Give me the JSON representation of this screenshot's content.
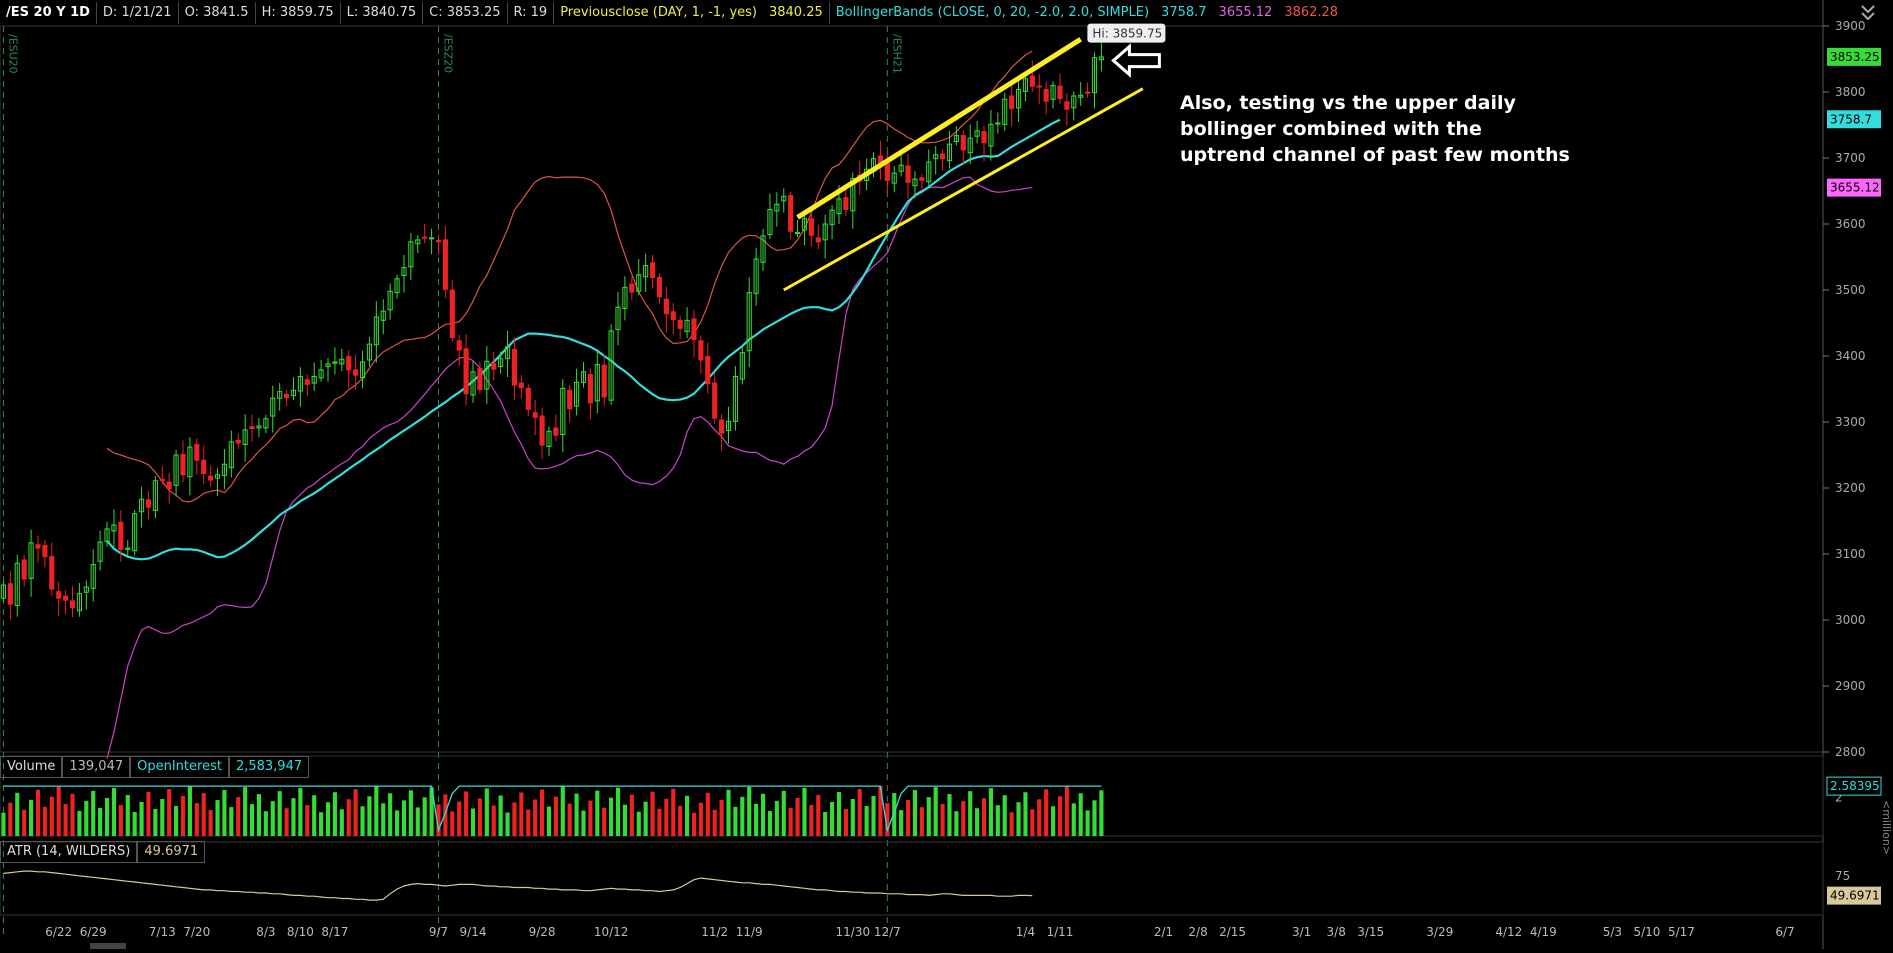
{
  "header": {
    "symbol": "/ES 20 Y 1D",
    "date": "D: 1/21/21",
    "open": "O: 3841.5",
    "high": "H: 3859.75",
    "low": "L: 3840.75",
    "close": "C: 3853.25",
    "range": "R: 19",
    "prev_close_label": "Previousclose (DAY, 1, -1, yes)",
    "prev_close_value": "3840.25",
    "bb_label": "BollingerBands (CLOSE, 0, 20, -2.0, 2.0, SIMPLE)",
    "bb_mid": "3758.7",
    "bb_lower": "3655.12",
    "bb_upper": "3862.28"
  },
  "annotation": {
    "text_lines": [
      "Also, testing vs the upper daily",
      "bollinger combined with the",
      "uptrend channel of past few months"
    ],
    "hi_label": "Hi: 3859.75"
  },
  "volume_panel": {
    "label": "Volume",
    "value": "139,047",
    "oi_label": "OpenInterest",
    "oi_value": "2,583,947",
    "scale_value": "2.58395",
    "unit": "<million>"
  },
  "atr_panel": {
    "label": "ATR (14, WILDERS)",
    "value": "49.6971",
    "scale_tick": "75"
  },
  "contract_markers": [
    "/ESU20",
    "/ESZ20",
    "/ESH21"
  ],
  "colors": {
    "up": "#33dd33",
    "down": "#ee2222",
    "bb_mid": "#33dddd",
    "bb_upper": "#dd5544",
    "bb_lower": "#cc44cc",
    "trend": "#ffee22",
    "atr": "#d8c89a",
    "prev_close": "#eeee44"
  },
  "chart_data": {
    "type": "candlestick",
    "ylim": [
      2800,
      3900
    ],
    "y_ticks": [
      2800,
      2900,
      3000,
      3100,
      3200,
      3300,
      3400,
      3500,
      3600,
      3700,
      3800,
      3900
    ],
    "price_tags": [
      {
        "value": 3853.25,
        "label": "3853.25",
        "color": "#33dd33"
      },
      {
        "value": 3758.7,
        "label": "3758.7",
        "color": "#33dddd"
      },
      {
        "value": 3655.12,
        "label": "3655.12",
        "color": "#ff66ff"
      }
    ],
    "x_tick_labels": [
      "6/22",
      "6/29",
      "7/13",
      "7/20",
      "8/3",
      "8/10",
      "8/17",
      "9/7",
      "9/14",
      "9/28",
      "10/12",
      "11/2",
      "11/9",
      "11/30",
      "12/7",
      "1/4",
      "1/11",
      "2/1",
      "2/8",
      "2/15",
      "3/1",
      "3/8",
      "3/15",
      "3/29",
      "4/12",
      "4/19",
      "5/3",
      "5/10",
      "5/17",
      "6/7"
    ],
    "x_tick_idx": [
      8,
      13,
      23,
      28,
      38,
      43,
      48,
      63,
      68,
      78,
      88,
      103,
      108,
      123,
      128,
      148,
      153,
      168,
      173,
      178,
      188,
      193,
      198,
      208,
      218,
      223,
      233,
      238,
      243,
      258
    ],
    "n_slots": 264,
    "n_bars": 150,
    "close": [
      3053,
      3024,
      3086,
      3062,
      3117,
      3109,
      3096,
      3047,
      3033,
      3030,
      3019,
      3040,
      3050,
      3084,
      3118,
      3138,
      3144,
      3107,
      3109,
      3161,
      3183,
      3171,
      3211,
      3211,
      3199,
      3250,
      3220,
      3262,
      3242,
      3222,
      3212,
      3220,
      3236,
      3270,
      3268,
      3288,
      3290,
      3294,
      3305,
      3336,
      3346,
      3337,
      3348,
      3369,
      3357,
      3369,
      3379,
      3388,
      3391,
      3395,
      3379,
      3371,
      3391,
      3418,
      3459,
      3468,
      3498,
      3517,
      3534,
      3573,
      3576,
      3579,
      3579,
      3573,
      3501,
      3428,
      3409,
      3343,
      3376,
      3349,
      3392,
      3380,
      3396,
      3414,
      3356,
      3352,
      3319,
      3307,
      3265,
      3286,
      3280,
      3351,
      3320,
      3360,
      3376,
      3329,
      3387,
      3338,
      3438,
      3474,
      3504,
      3497,
      3523,
      3537,
      3519,
      3490,
      3464,
      3455,
      3442,
      3454,
      3425,
      3394,
      3358,
      3306,
      3283,
      3301,
      3369,
      3405,
      3496,
      3547,
      3582,
      3622,
      3630,
      3642,
      3589,
      3587,
      3608,
      3583,
      3573,
      3600,
      3621,
      3638,
      3622,
      3669,
      3665,
      3683,
      3699,
      3693,
      3666,
      3677,
      3689,
      3663,
      3668,
      3666,
      3694,
      3705,
      3699,
      3721,
      3734,
      3712,
      3730,
      3741,
      3723,
      3751,
      3753,
      3789,
      3775,
      3804,
      3820,
      3809,
      3808,
      3786,
      3810,
      3790,
      3774,
      3794,
      3795,
      3798,
      3852,
      3853
    ],
    "bb_upper": [
      3260,
      3253,
      3250,
      3246,
      3243,
      3240,
      3235,
      3224,
      3210,
      3196,
      3189,
      3180,
      3179,
      3184,
      3192,
      3195,
      3197,
      3193,
      3204,
      3221,
      3234,
      3244,
      3256,
      3265,
      3277,
      3290,
      3295,
      3303,
      3304,
      3299,
      3300,
      3310,
      3320,
      3334,
      3339,
      3349,
      3356,
      3366,
      3381,
      3396,
      3406,
      3412,
      3418,
      3424,
      3425,
      3427,
      3428,
      3433,
      3441,
      3448,
      3449,
      3452,
      3464,
      3483,
      3506,
      3522,
      3545,
      3568,
      3592,
      3621,
      3635,
      3650,
      3664,
      3670,
      3672,
      3670,
      3671,
      3671,
      3671,
      3670,
      3667,
      3660,
      3647,
      3621,
      3584,
      3553,
      3524,
      3497,
      3479,
      3464,
      3442,
      3427,
      3419,
      3420,
      3422,
      3434,
      3452,
      3477,
      3510,
      3536,
      3557,
      3569,
      3579,
      3583,
      3582,
      3576,
      3566,
      3560,
      3561,
      3564,
      3576,
      3593,
      3617,
      3645,
      3669,
      3685,
      3690,
      3703,
      3718,
      3733,
      3747,
      3755,
      3757,
      3752,
      3744,
      3738,
      3731,
      3726,
      3723,
      3723,
      3724,
      3727,
      3731,
      3740,
      3751,
      3760,
      3771,
      3786,
      3798,
      3813,
      3824,
      3837,
      3847,
      3856,
      3862
    ],
    "bb_mid": [
      3120,
      3108,
      3101,
      3096,
      3093,
      3092,
      3093,
      3097,
      3102,
      3106,
      3108,
      3107,
      3107,
      3106,
      3103,
      3099,
      3095,
      3096,
      3101,
      3107,
      3114,
      3122,
      3131,
      3140,
      3149,
      3159,
      3166,
      3172,
      3180,
      3186,
      3192,
      3199,
      3207,
      3214,
      3221,
      3229,
      3236,
      3243,
      3251,
      3258,
      3265,
      3273,
      3280,
      3287,
      3294,
      3301,
      3308,
      3316,
      3323,
      3330,
      3338,
      3345,
      3353,
      3362,
      3371,
      3381,
      3391,
      3402,
      3413,
      3424,
      3429,
      3434,
      3434,
      3433,
      3432,
      3430,
      3429,
      3426,
      3422,
      3418,
      3414,
      3408,
      3400,
      3393,
      3384,
      3377,
      3368,
      3358,
      3350,
      3342,
      3336,
      3334,
      3333,
      3334,
      3337,
      3343,
      3354,
      3365,
      3377,
      3389,
      3399,
      3407,
      3415,
      3425,
      3432,
      3440,
      3446,
      3452,
      3458,
      3464,
      3469,
      3473,
      3474,
      3474,
      3471,
      3469,
      3474,
      3483,
      3496,
      3511,
      3529,
      3548,
      3566,
      3584,
      3601,
      3618,
      3634,
      3643,
      3649,
      3656,
      3664,
      3672,
      3680,
      3686,
      3692,
      3698,
      3701,
      3703,
      3702,
      3703,
      3710,
      3717,
      3723,
      3729,
      3735,
      3741,
      3747,
      3753,
      3758
    ],
    "bb_lower": [
      2790,
      2830,
      2880,
      2930,
      2960,
      2985,
      2990,
      2985,
      2980,
      2980,
      2985,
      2992,
      2995,
      3000,
      3005,
      3010,
      3020,
      3023,
      3022,
      3020,
      3019,
      3020,
      3033,
      3055,
      3095,
      3135,
      3165,
      3180,
      3190,
      3200,
      3206,
      3215,
      3222,
      3230,
      3237,
      3243,
      3255,
      3263,
      3275,
      3283,
      3291,
      3296,
      3300,
      3308,
      3318,
      3330,
      3342,
      3355,
      3367,
      3380,
      3389,
      3397,
      3398,
      3393,
      3382,
      3364,
      3349,
      3332,
      3308,
      3285,
      3266,
      3244,
      3230,
      3229,
      3230,
      3233,
      3237,
      3244,
      3249,
      3250,
      3253,
      3257,
      3253,
      3247,
      3235,
      3220,
      3212,
      3208,
      3207,
      3205,
      3210,
      3218,
      3230,
      3250,
      3285,
      3305,
      3308,
      3300,
      3288,
      3278,
      3264,
      3260,
      3256,
      3254,
      3254,
      3248,
      3242,
      3240,
      3236,
      3244,
      3248,
      3256,
      3262,
      3275,
      3291,
      3325,
      3395,
      3463,
      3501,
      3516,
      3526,
      3536,
      3545,
      3556,
      3581,
      3607,
      3629,
      3645,
      3651,
      3655,
      3656,
      3655,
      3660,
      3665,
      3670,
      3671,
      3660,
      3655,
      3650,
      3648,
      3649,
      3651,
      3652,
      3654,
      3655
    ],
    "bb_offset": 15,
    "trend_upper": {
      "x1": 115,
      "y1": 3610,
      "x2": 156,
      "y2": 3880
    },
    "trend_lower": {
      "x1": 113,
      "y1": 3500,
      "x2": 165,
      "y2": 3805
    },
    "hi_value": 3859.75,
    "volume_ylim": [
      0,
      3
    ],
    "volume_tick": 2,
    "volume_label": "2",
    "oi_level": 2.58,
    "atr_ylim": [
      25,
      90
    ],
    "atr_tick": 75,
    "atr": [
      78,
      79,
      80,
      81,
      81,
      80,
      80,
      79,
      78,
      77,
      76,
      75,
      74,
      73,
      72,
      71,
      70,
      69,
      68,
      67,
      66,
      65,
      64,
      63,
      62,
      61,
      60,
      59,
      58,
      57,
      57,
      56,
      56,
      55,
      55,
      54,
      54,
      53,
      53,
      52,
      52,
      51,
      50,
      50,
      49,
      49,
      48,
      47,
      47,
      46,
      46,
      45,
      45,
      44,
      44,
      45,
      52,
      58,
      62,
      64,
      65,
      64,
      64,
      63,
      62,
      63,
      64,
      64,
      64,
      63,
      62,
      62,
      61,
      61,
      60,
      60,
      60,
      59,
      59,
      58,
      58,
      57,
      57,
      57,
      56,
      56,
      57,
      58,
      59,
      58,
      58,
      57,
      57,
      56,
      56,
      55,
      56,
      57,
      60,
      65,
      70,
      72,
      71,
      70,
      69,
      68,
      67,
      66,
      66,
      65,
      64,
      64,
      63,
      62,
      61,
      60,
      59,
      58,
      57,
      57,
      56,
      55,
      55,
      54,
      54,
      53,
      53,
      53,
      52,
      52,
      52,
      51,
      51,
      51,
      50,
      51,
      52,
      52,
      51,
      50,
      50,
      50,
      50,
      50,
      49,
      49,
      49,
      50,
      50,
      49.7
    ]
  }
}
